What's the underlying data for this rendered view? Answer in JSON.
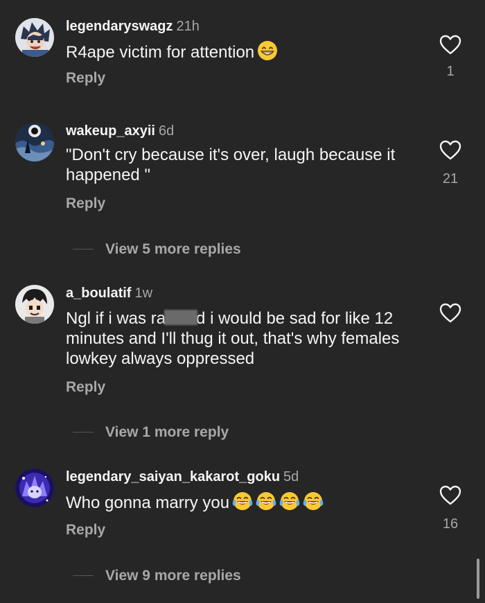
{
  "comments": [
    {
      "username": "legendaryswagz",
      "time": "21h",
      "text": "R4ape victim for attention",
      "emojis": [
        "grinning-face"
      ],
      "reply_label": "Reply",
      "likes": "1"
    },
    {
      "username": "wakeup_axyii",
      "time": "6d",
      "text": "\"Don't cry because it's over, laugh because it happened \"",
      "reply_label": "Reply",
      "likes": "21",
      "view_more": "View 5 more replies"
    },
    {
      "username": "a_boulatif",
      "time": "1w",
      "text_before": "Ngl if i was ra",
      "text_after": "d i would be sad for like 12 minutes and I'll thug it out, that's why females lowkey always oppressed",
      "reply_label": "Reply",
      "likes": "",
      "view_more": "View 1 more reply"
    },
    {
      "username": "legendary_saiyan_kakarot_goku",
      "time": "5d",
      "text": "Who gonna marry you",
      "emojis": [
        "tears-of-joy",
        "tears-of-joy",
        "tears-of-joy",
        "tears-of-joy"
      ],
      "reply_label": "Reply",
      "likes": "16",
      "view_more": "View 9 more replies"
    }
  ],
  "colors": {
    "background": "#262626",
    "primary_text": "#f5f5f5",
    "secondary_text": "#a8a8a8"
  }
}
